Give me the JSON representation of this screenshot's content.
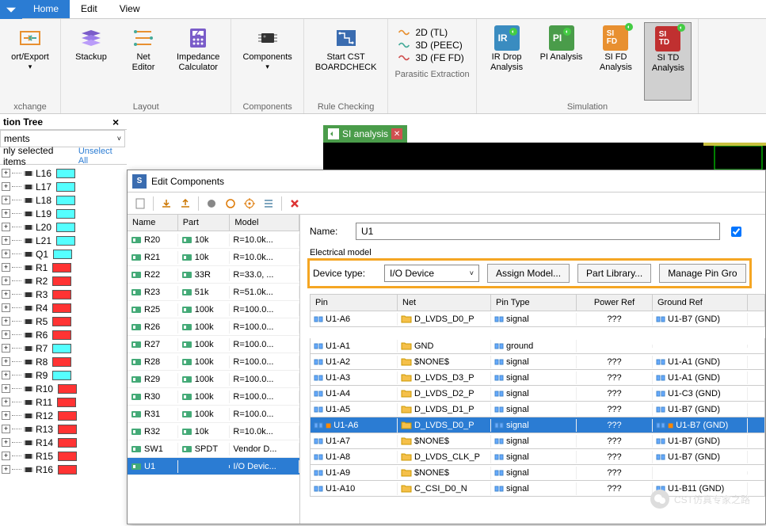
{
  "tabs": {
    "home": "Home",
    "edit": "Edit",
    "view": "View"
  },
  "ribbon": {
    "exchange": {
      "import_export": "ort/Export",
      "label": "xchange"
    },
    "layout": {
      "stackup": "Stackup",
      "net_editor": "Net\nEditor",
      "impedance": "Impedance\nCalculator",
      "label": "Layout"
    },
    "components": {
      "components": "Components",
      "label": "Components"
    },
    "rule": {
      "start_cst": "Start CST\nBOARDCHECK",
      "label": "Rule Checking"
    },
    "parasitic": {
      "tl": "2D (TL)",
      "peec": "3D (PEEC)",
      "fefd": "3D (FE FD)",
      "label": "Parasitic Extraction"
    },
    "simulation": {
      "ir": "IR Drop\nAnalysis",
      "pi": "PI Analysis",
      "sifd": "SI FD\nAnalysis",
      "sitd": "SI TD\nAnalysis",
      "label": "Simulation"
    }
  },
  "nav": {
    "title": "tion Tree",
    "dropdown": "ments",
    "filter": "nly selected items",
    "unselect": "Unselect All",
    "items": [
      {
        "label": "L16",
        "color": "#5ff"
      },
      {
        "label": "L17",
        "color": "#5ff"
      },
      {
        "label": "L18",
        "color": "#5ff"
      },
      {
        "label": "L19",
        "color": "#5ff"
      },
      {
        "label": "L20",
        "color": "#5ff"
      },
      {
        "label": "L21",
        "color": "#5ff"
      },
      {
        "label": "Q1",
        "color": "#5ff"
      },
      {
        "label": "R1",
        "color": "#f33"
      },
      {
        "label": "R2",
        "color": "#f33"
      },
      {
        "label": "R3",
        "color": "#f33"
      },
      {
        "label": "R4",
        "color": "#f33"
      },
      {
        "label": "R5",
        "color": "#f33"
      },
      {
        "label": "R6",
        "color": "#f33"
      },
      {
        "label": "R7",
        "color": "#5ff"
      },
      {
        "label": "R8",
        "color": "#f33"
      },
      {
        "label": "R9",
        "color": "#5ff"
      },
      {
        "label": "R10",
        "color": "#f33"
      },
      {
        "label": "R11",
        "color": "#f33"
      },
      {
        "label": "R12",
        "color": "#f33"
      },
      {
        "label": "R13",
        "color": "#f33"
      },
      {
        "label": "R14",
        "color": "#f33"
      },
      {
        "label": "R15",
        "color": "#f33"
      },
      {
        "label": "R16",
        "color": "#f33"
      }
    ]
  },
  "doc_tab": "SI analysis",
  "popup": {
    "title": "Edit Components",
    "cols": {
      "name": "Name",
      "part": "Part",
      "model": "Model"
    },
    "rows": [
      {
        "name": "R20",
        "part": "10k",
        "model": "R=10.0k..."
      },
      {
        "name": "R21",
        "part": "10k",
        "model": "R=10.0k..."
      },
      {
        "name": "R22",
        "part": "33R",
        "model": "R=33.0, ..."
      },
      {
        "name": "R23",
        "part": "51k",
        "model": "R=51.0k..."
      },
      {
        "name": "R25",
        "part": "100k",
        "model": "R=100.0..."
      },
      {
        "name": "R26",
        "part": "100k",
        "model": "R=100.0..."
      },
      {
        "name": "R27",
        "part": "100k",
        "model": "R=100.0..."
      },
      {
        "name": "R28",
        "part": "100k",
        "model": "R=100.0..."
      },
      {
        "name": "R29",
        "part": "100k",
        "model": "R=100.0..."
      },
      {
        "name": "R30",
        "part": "100k",
        "model": "R=100.0..."
      },
      {
        "name": "R31",
        "part": "100k",
        "model": "R=100.0..."
      },
      {
        "name": "R32",
        "part": "10k",
        "model": "R=10.0k..."
      },
      {
        "name": "SW1",
        "part": "SPDT",
        "model": "Vendor D..."
      },
      {
        "name": "U1",
        "part": "",
        "model": "I/O Devic...",
        "selected": true
      }
    ],
    "form": {
      "name_label": "Name:",
      "name_value": "U1",
      "electrical": "Electrical model",
      "device_label": "Device type:",
      "device_value": "I/O Device",
      "assign": "Assign Model...",
      "partlib": "Part Library...",
      "manage": "Manage Pin Gro"
    },
    "pin_cols": {
      "pin": "Pin",
      "net": "Net",
      "type": "Pin Type",
      "pwr": "Power Ref",
      "gnd": "Ground Ref"
    },
    "pin_single": {
      "pin": "U1-A6",
      "net": "D_LVDS_D0_P",
      "type": "signal",
      "pwr": "???",
      "gnd": "U1-B7 (GND)"
    },
    "pins": [
      {
        "pin": "U1-A1",
        "net": "GND",
        "type": "ground",
        "pwr": "",
        "gnd": ""
      },
      {
        "pin": "U1-A2",
        "net": "$NONE$",
        "type": "signal",
        "pwr": "???",
        "gnd": "U1-A1 (GND)"
      },
      {
        "pin": "U1-A3",
        "net": "D_LVDS_D3_P",
        "type": "signal",
        "pwr": "???",
        "gnd": "U1-A1 (GND)"
      },
      {
        "pin": "U1-A4",
        "net": "D_LVDS_D2_P",
        "type": "signal",
        "pwr": "???",
        "gnd": "U1-C3 (GND)"
      },
      {
        "pin": "U1-A5",
        "net": "D_LVDS_D1_P",
        "type": "signal",
        "pwr": "???",
        "gnd": "U1-B7 (GND)"
      },
      {
        "pin": "U1-A6",
        "net": "D_LVDS_D0_P",
        "type": "signal",
        "pwr": "???",
        "gnd": "U1-B7 (GND)",
        "selected": true,
        "marked": true
      },
      {
        "pin": "U1-A7",
        "net": "$NONE$",
        "type": "signal",
        "pwr": "???",
        "gnd": "U1-B7 (GND)"
      },
      {
        "pin": "U1-A8",
        "net": "D_LVDS_CLK_P",
        "type": "signal",
        "pwr": "???",
        "gnd": "U1-B7 (GND)"
      },
      {
        "pin": "U1-A9",
        "net": "$NONE$",
        "type": "signal",
        "pwr": "???",
        "gnd": ""
      },
      {
        "pin": "U1-A10",
        "net": "C_CSI_D0_N",
        "type": "signal",
        "pwr": "???",
        "gnd": "U1-B11 (GND)"
      }
    ]
  },
  "watermark": "CST仿真专家之路"
}
